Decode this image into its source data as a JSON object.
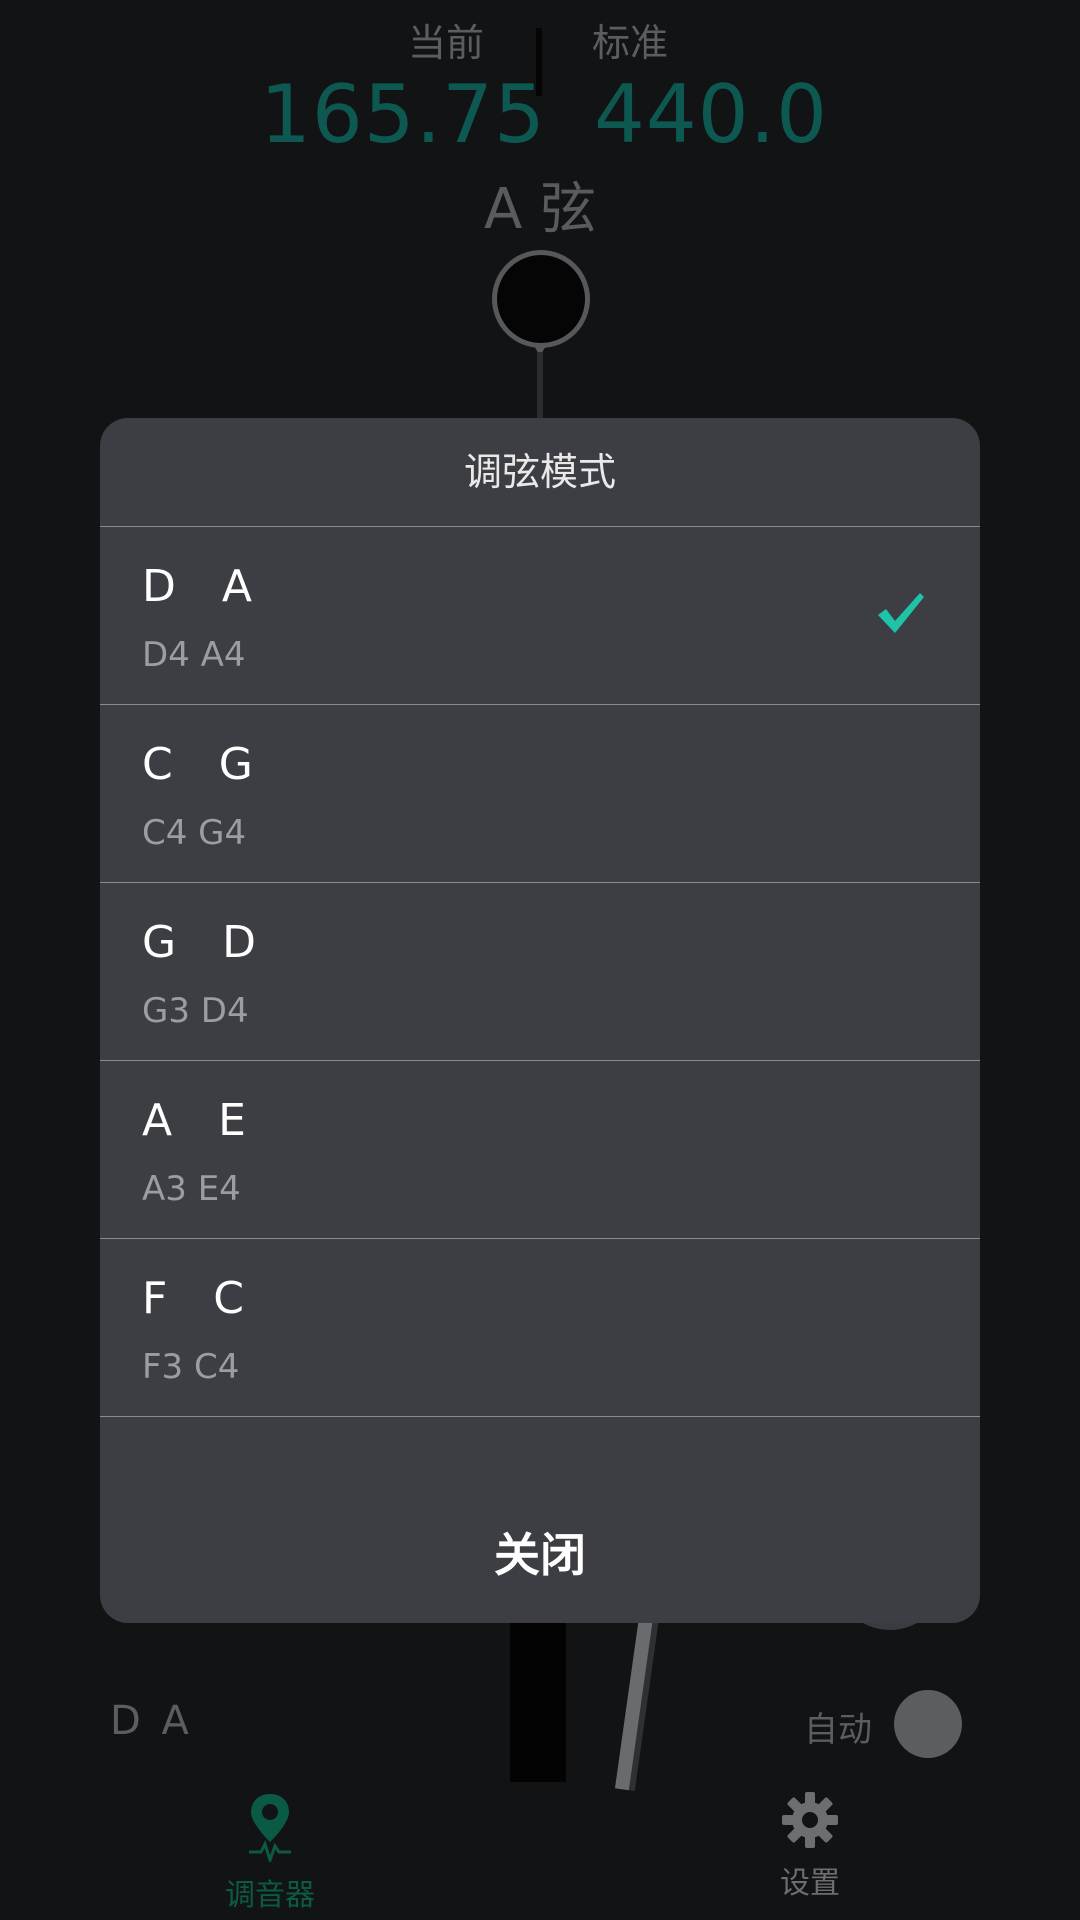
{
  "header": {
    "current_label": "当前",
    "standard_label": "标准",
    "current_freq": "165.75",
    "standard_freq": "440.0",
    "string_name": "A 弦"
  },
  "dialog": {
    "title": "调弦模式",
    "options": [
      {
        "name": "D  A",
        "notes": "D4 A4",
        "selected": true
      },
      {
        "name": "C  G",
        "notes": "C4 G4",
        "selected": false
      },
      {
        "name": "G  D",
        "notes": "G3 D4",
        "selected": false
      },
      {
        "name": "A  E",
        "notes": "A3 E4",
        "selected": false
      },
      {
        "name": "F  C",
        "notes": "F3 C4",
        "selected": false
      }
    ],
    "close_label": "关闭"
  },
  "controls": {
    "current_mode": "D  A",
    "auto_label": "自动"
  },
  "nav": {
    "tuner_label": "调音器",
    "settings_label": "设置"
  },
  "colors": {
    "accent": "#1fc3a8",
    "freq": "#0d5952",
    "nav_active": "#0b5a45",
    "dialog_bg": "#3d3e43"
  }
}
